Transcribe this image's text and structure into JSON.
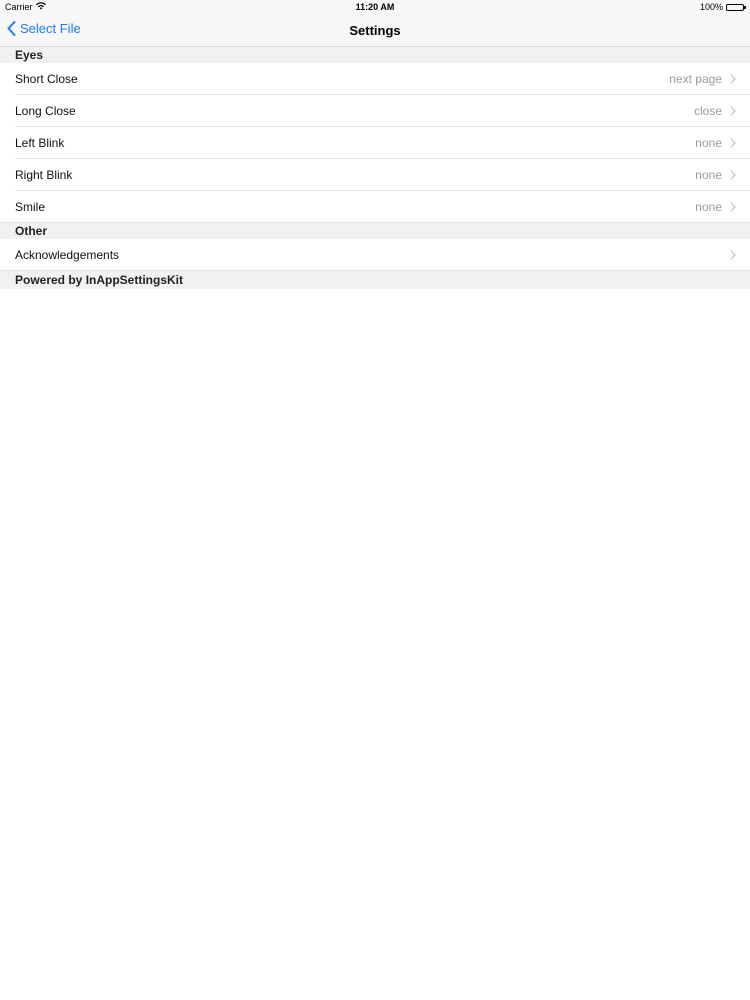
{
  "status_bar": {
    "carrier": "Carrier",
    "time": "11:20 AM",
    "battery": "100%"
  },
  "nav": {
    "back_label": "Select File",
    "title": "Settings"
  },
  "sections": {
    "eyes": {
      "header": "Eyes",
      "items": [
        {
          "label": "Short Close",
          "value": "next page"
        },
        {
          "label": "Long Close",
          "value": "close"
        },
        {
          "label": "Left Blink",
          "value": "none"
        },
        {
          "label": "Right Blink",
          "value": "none"
        },
        {
          "label": "Smile",
          "value": "none"
        }
      ]
    },
    "other": {
      "header": "Other",
      "items": [
        {
          "label": "Acknowledgements",
          "value": ""
        }
      ]
    }
  },
  "footer": {
    "text": "Powered by InAppSettingsKit"
  },
  "colors": {
    "accent": "#1a7cf5",
    "value_gray": "#9a9a9f",
    "section_bg": "#f1f1f3"
  }
}
